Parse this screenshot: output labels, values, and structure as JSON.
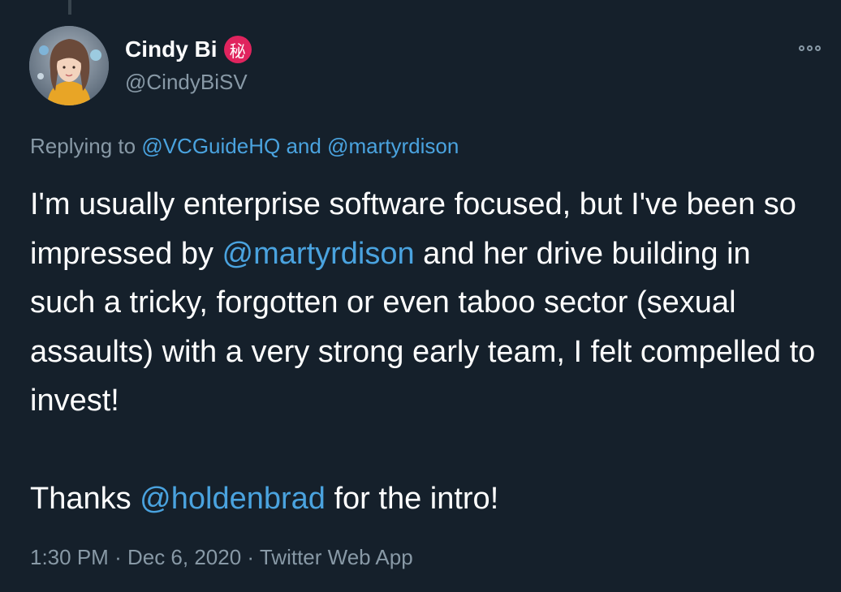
{
  "author": {
    "display_name": "Cindy Bi",
    "badge": "秘",
    "handle": "@CindyBiSV"
  },
  "replying": {
    "prefix": "Replying to",
    "users": [
      "@VCGuideHQ",
      "@martyrdison"
    ],
    "joiner": "and"
  },
  "body": {
    "line1_a": "I'm usually enterprise software focused, but I've been so impressed by ",
    "mention1": "@martyrdison",
    "line1_b": " and her drive building in such a tricky, forgotten or even taboo sector (sexual assaults) with a very strong early team, I felt compelled to invest!",
    "line2_a": "Thanks ",
    "mention2": "@holdenbrad",
    "line2_b": " for the intro!"
  },
  "meta": {
    "time": "1:30 PM",
    "date": "Dec 6, 2020",
    "source": "Twitter Web App",
    "separator": "·"
  },
  "icons": {
    "more": "more-options-icon"
  },
  "colors": {
    "background": "#15202b",
    "link": "#4aa3df",
    "muted": "#8899a6",
    "badge": "#e0245e"
  }
}
